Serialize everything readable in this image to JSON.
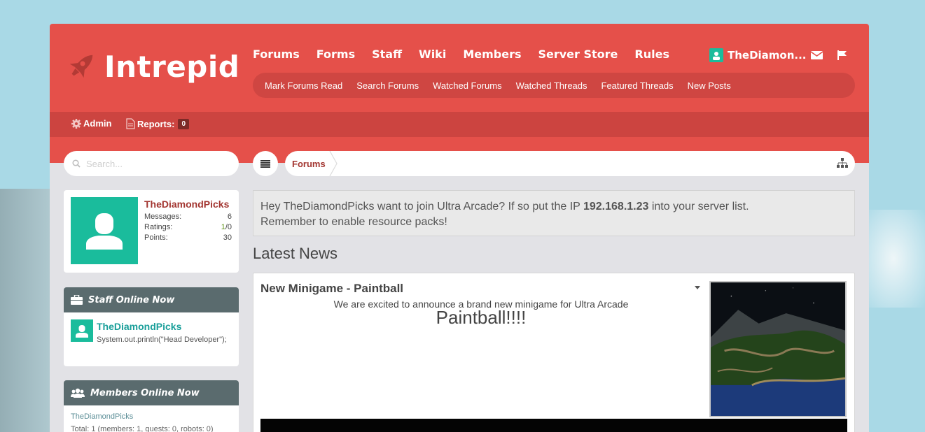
{
  "site": {
    "logo_text": "Intrepid"
  },
  "nav": {
    "main": [
      "Forums",
      "Forms",
      "Staff",
      "Wiki",
      "Members",
      "Server Store",
      "Rules"
    ],
    "sub": [
      "Mark Forums Read",
      "Search Forums",
      "Watched Forums",
      "Watched Threads",
      "Featured Threads",
      "New Posts"
    ]
  },
  "user": {
    "display_name": "TheDiamon..."
  },
  "adminbar": {
    "admin_label": "Admin",
    "reports_label": "Reports:",
    "reports_count": "0"
  },
  "search": {
    "placeholder": "Search..."
  },
  "breadcrumb": {
    "current": "Forums"
  },
  "profile": {
    "name": "TheDiamondPicks",
    "messages_label": "Messages:",
    "messages": "6",
    "ratings_label": "Ratings:",
    "ratings_pos": "1",
    "ratings_rest": "/0",
    "points_label": "Points:",
    "points": "30"
  },
  "staff_widget": {
    "title": "Staff Online Now",
    "name": "TheDiamondPicks",
    "user_title": "System.out.println(\"Head Developer\");"
  },
  "members_widget": {
    "title": "Members Online Now",
    "member": "TheDiamondPicks",
    "total": "Total: 1 (members: 1, guests: 0, robots: 0)"
  },
  "notice": {
    "part1": "Hey TheDiamondPicks want to join Ultra Arcade? If so put the IP ",
    "ip": "192.168.1.23",
    "part2": " into your server list.",
    "line2": "Remember to enable resource packs!"
  },
  "latest_news": {
    "heading": "Latest News",
    "item_title": "New Minigame - Paintball",
    "line1": "We are excited to announce a brand new minigame for Ultra Arcade",
    "line2": "Paintball!!!!"
  },
  "colors": {
    "accent": "#e5504a",
    "teal": "#1abc9c",
    "widget_header": "#5a6b6e"
  },
  "icons": [
    "rocket-icon",
    "envelope-icon",
    "flag-icon",
    "gear-icon",
    "document-icon",
    "search-icon",
    "hamburger-icon",
    "sitemap-icon",
    "user-icon",
    "briefcase-icon",
    "users-icon",
    "chevron-down-icon"
  ]
}
